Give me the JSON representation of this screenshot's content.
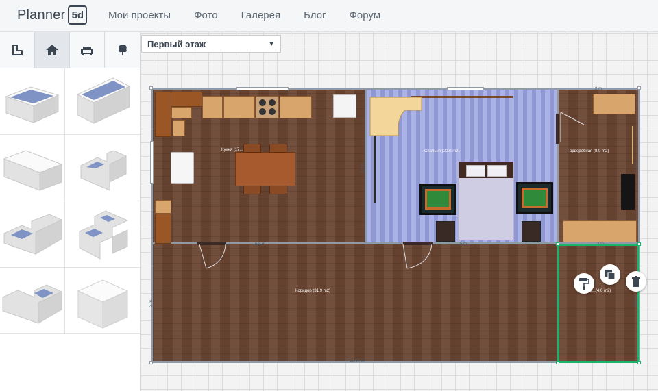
{
  "app": {
    "logo_text": "Planner",
    "logo_badge": "5d"
  },
  "nav": {
    "items": [
      "Мои проекты",
      "Фото",
      "Галерея",
      "Блог",
      "Форум"
    ]
  },
  "sidebar": {
    "tabs": [
      {
        "icon": "room-shape-icon",
        "active": false
      },
      {
        "icon": "house-icon",
        "active": true
      },
      {
        "icon": "sofa-icon",
        "active": false
      },
      {
        "icon": "tree-icon",
        "active": false
      }
    ],
    "room_templates": [
      "rectangle-room",
      "rectangle-room-deep",
      "wide-room",
      "corner-cut-room",
      "l-shaped-room",
      "t-shaped-room",
      "corner-room",
      "solid-block"
    ]
  },
  "floor_selector": {
    "value": "Первый этаж"
  },
  "plan": {
    "rooms": {
      "kitchen": "Кухня (17...",
      "bedroom": "Спальня (20.0 m2)",
      "wardrobe": "Гардеробная (8.0 m2)",
      "corridor": "Коридор (31.9 m2)",
      "selected": "Б...(4.0 m2)"
    },
    "dimensions": {
      "top_right": "2 m",
      "kitchen_bottom": "5.5 m",
      "bedroom_bottom": "5 m",
      "wardrobe_bottom": "2 m",
      "overall_bottom": "10.64 m",
      "selected_bottom": "2 m",
      "kitchen_height": "4.0 m",
      "wardrobe_height": "4 m",
      "corridor_height": "3 m",
      "selected_left": "2.90 m",
      "selected_right": "2.90 m"
    }
  },
  "colors": {
    "selection": "#19b46a",
    "wood_floor": "#6a4532",
    "bedroom_floor": "#9ea6dd"
  },
  "toolbar": {
    "paint": "paint-roller-icon",
    "copy": "copy-icon",
    "delete": "trash-icon"
  }
}
